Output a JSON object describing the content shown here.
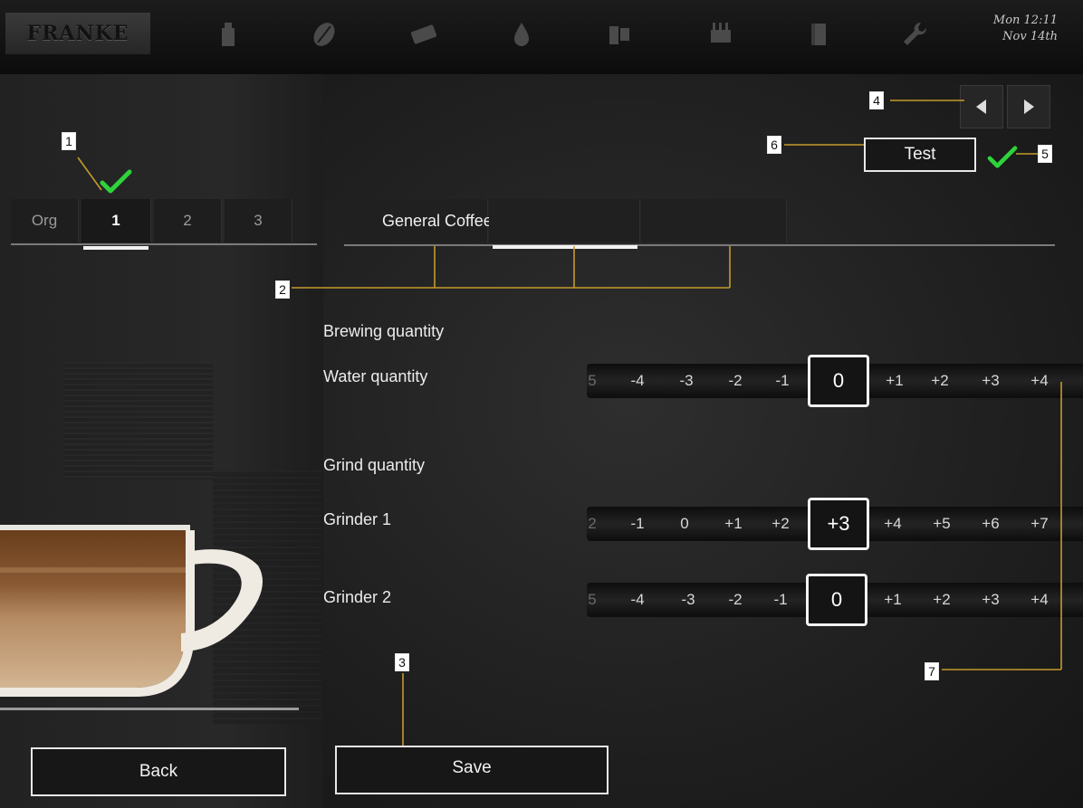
{
  "header": {
    "brand": "FRANKE",
    "clock_day_time": "Mon 12:11",
    "clock_date": "Nov 14th",
    "nav_icons": [
      "beverage-icon",
      "coffee-bean-icon",
      "chocolate-icon",
      "water-drop-icon",
      "cleaning-icon",
      "cup-rack-icon",
      "book-icon",
      "wrench-icon"
    ]
  },
  "recipe_tabs": [
    {
      "label": "Org"
    },
    {
      "label": "1"
    },
    {
      "label": "2"
    },
    {
      "label": "3"
    }
  ],
  "category_tabs": [
    {
      "label": "General Coffee"
    },
    {
      "label": ""
    },
    {
      "label": ""
    }
  ],
  "test_button": "Test",
  "sections": {
    "brewing": "Brewing quantity",
    "water": "Water quantity",
    "grind": "Grind quantity",
    "grinder1": "Grinder 1",
    "grinder2": "Grinder 2"
  },
  "scales": {
    "water": {
      "edge": "5",
      "ticks": [
        "-4",
        "-3",
        "-2",
        "-1",
        "0",
        "+1",
        "+2",
        "+3",
        "+4"
      ],
      "selected": "0"
    },
    "grinder1": {
      "edge": "2",
      "ticks": [
        "-1",
        "0",
        "+1",
        "+2",
        "+3",
        "+4",
        "+5",
        "+6",
        "+7"
      ],
      "selected": "+3"
    },
    "grinder2": {
      "edge": "5",
      "ticks": [
        "-4",
        "-3",
        "-2",
        "-1",
        "0",
        "+1",
        "+2",
        "+3",
        "+4"
      ],
      "selected": "0"
    }
  },
  "buttons": {
    "back": "Back",
    "save": "Save"
  },
  "callouts": [
    "1",
    "2",
    "3",
    "4",
    "5",
    "6",
    "7"
  ],
  "colors": {
    "check": "#2fd33a",
    "callout_line": "#c49a2c"
  }
}
